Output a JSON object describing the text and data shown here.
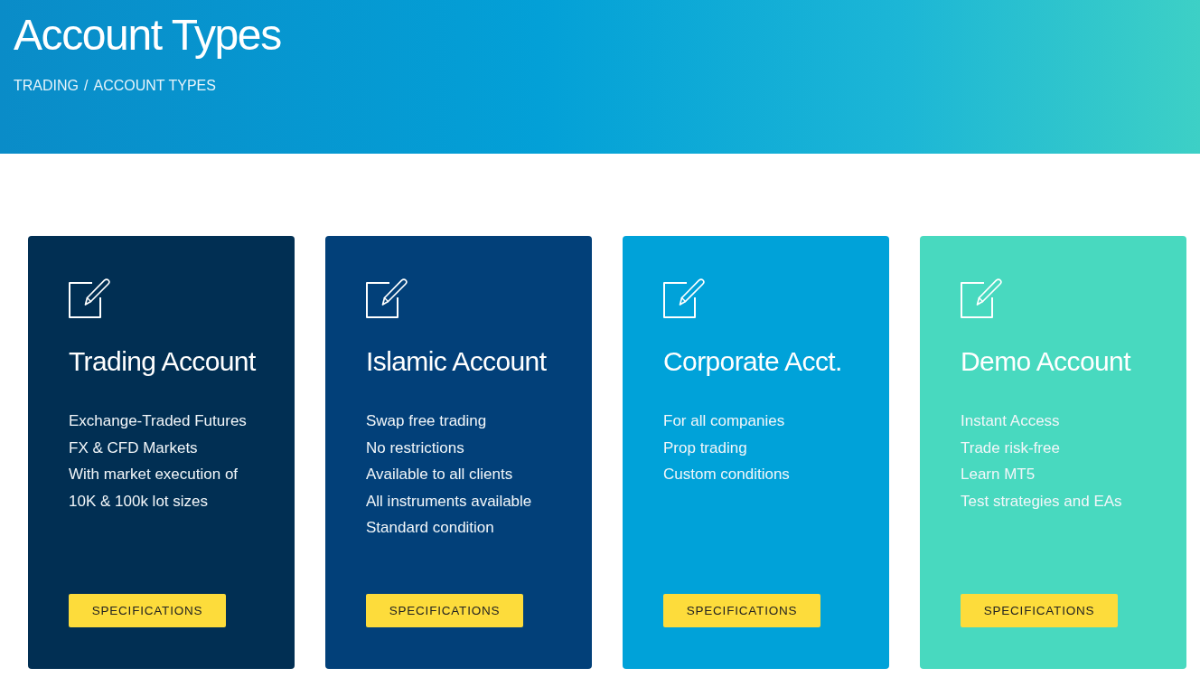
{
  "header": {
    "title": "Account Types",
    "breadcrumb": {
      "items": [
        "TRADING",
        "ACCOUNT TYPES"
      ],
      "separator": "/"
    }
  },
  "cards": [
    {
      "title": "Trading Account",
      "color": "#012f53",
      "features": [
        "Exchange-Traded Futures",
        "FX & CFD Markets",
        "With market execution of",
        "10K & 100k lot sizes"
      ],
      "button": "SPECIFICATIONS"
    },
    {
      "title": "Islamic Account",
      "color": "#024079",
      "features": [
        "Swap free trading",
        "No restrictions",
        "Available to all clients",
        "All instruments available",
        "Standard condition"
      ],
      "button": "SPECIFICATIONS"
    },
    {
      "title": "Corporate Acct.",
      "color": "#00a2d9",
      "features": [
        "For all companies",
        "Prop trading",
        "Custom conditions"
      ],
      "button": "SPECIFICATIONS"
    },
    {
      "title": "Demo Account",
      "color": "#48d9bf",
      "features": [
        "Instant Access",
        "Trade risk-free",
        "Learn MT5",
        "Test strategies and EAs"
      ],
      "button": "SPECIFICATIONS"
    }
  ]
}
